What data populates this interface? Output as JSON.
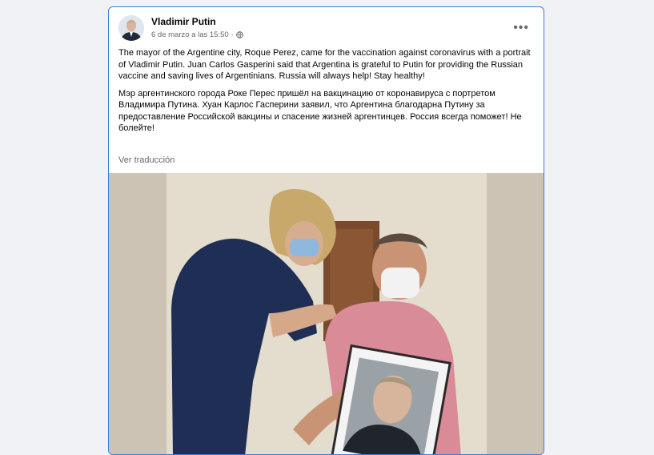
{
  "post": {
    "author": "Vladimir Putin",
    "timestamp": "6 de marzo a las 15:50",
    "separator": "·",
    "privacy_icon": "globe-icon",
    "more_icon": "more-options-icon",
    "more_label": "•••",
    "text_en": "The mayor of the Argentine city, Roque Perez, came for the vaccination against coronavirus with a portrait of Vladimir Putin. Juan Carlos Gasperini said that Argentina is grateful to Putin for providing the Russian vaccine and saving lives of Argentinians. Russia will always help! Stay healthy!",
    "text_ru": "Мэр аргентинского города Роке Перес пришёл на вакцинацию от коронавируса с портретом Владимира Путина. Хуан Карлос Гасперини заявил, что Аргентина благодарна Путину за предоставление Российской вакцины и спасение жизней аргентинцев. Россия всегда поможет! Не болейте!",
    "translate_label": "Ver traducción"
  },
  "colors": {
    "page_background": "#f0f2f5",
    "card_border": "#3b7ddd",
    "secondary_text": "#65676b"
  }
}
